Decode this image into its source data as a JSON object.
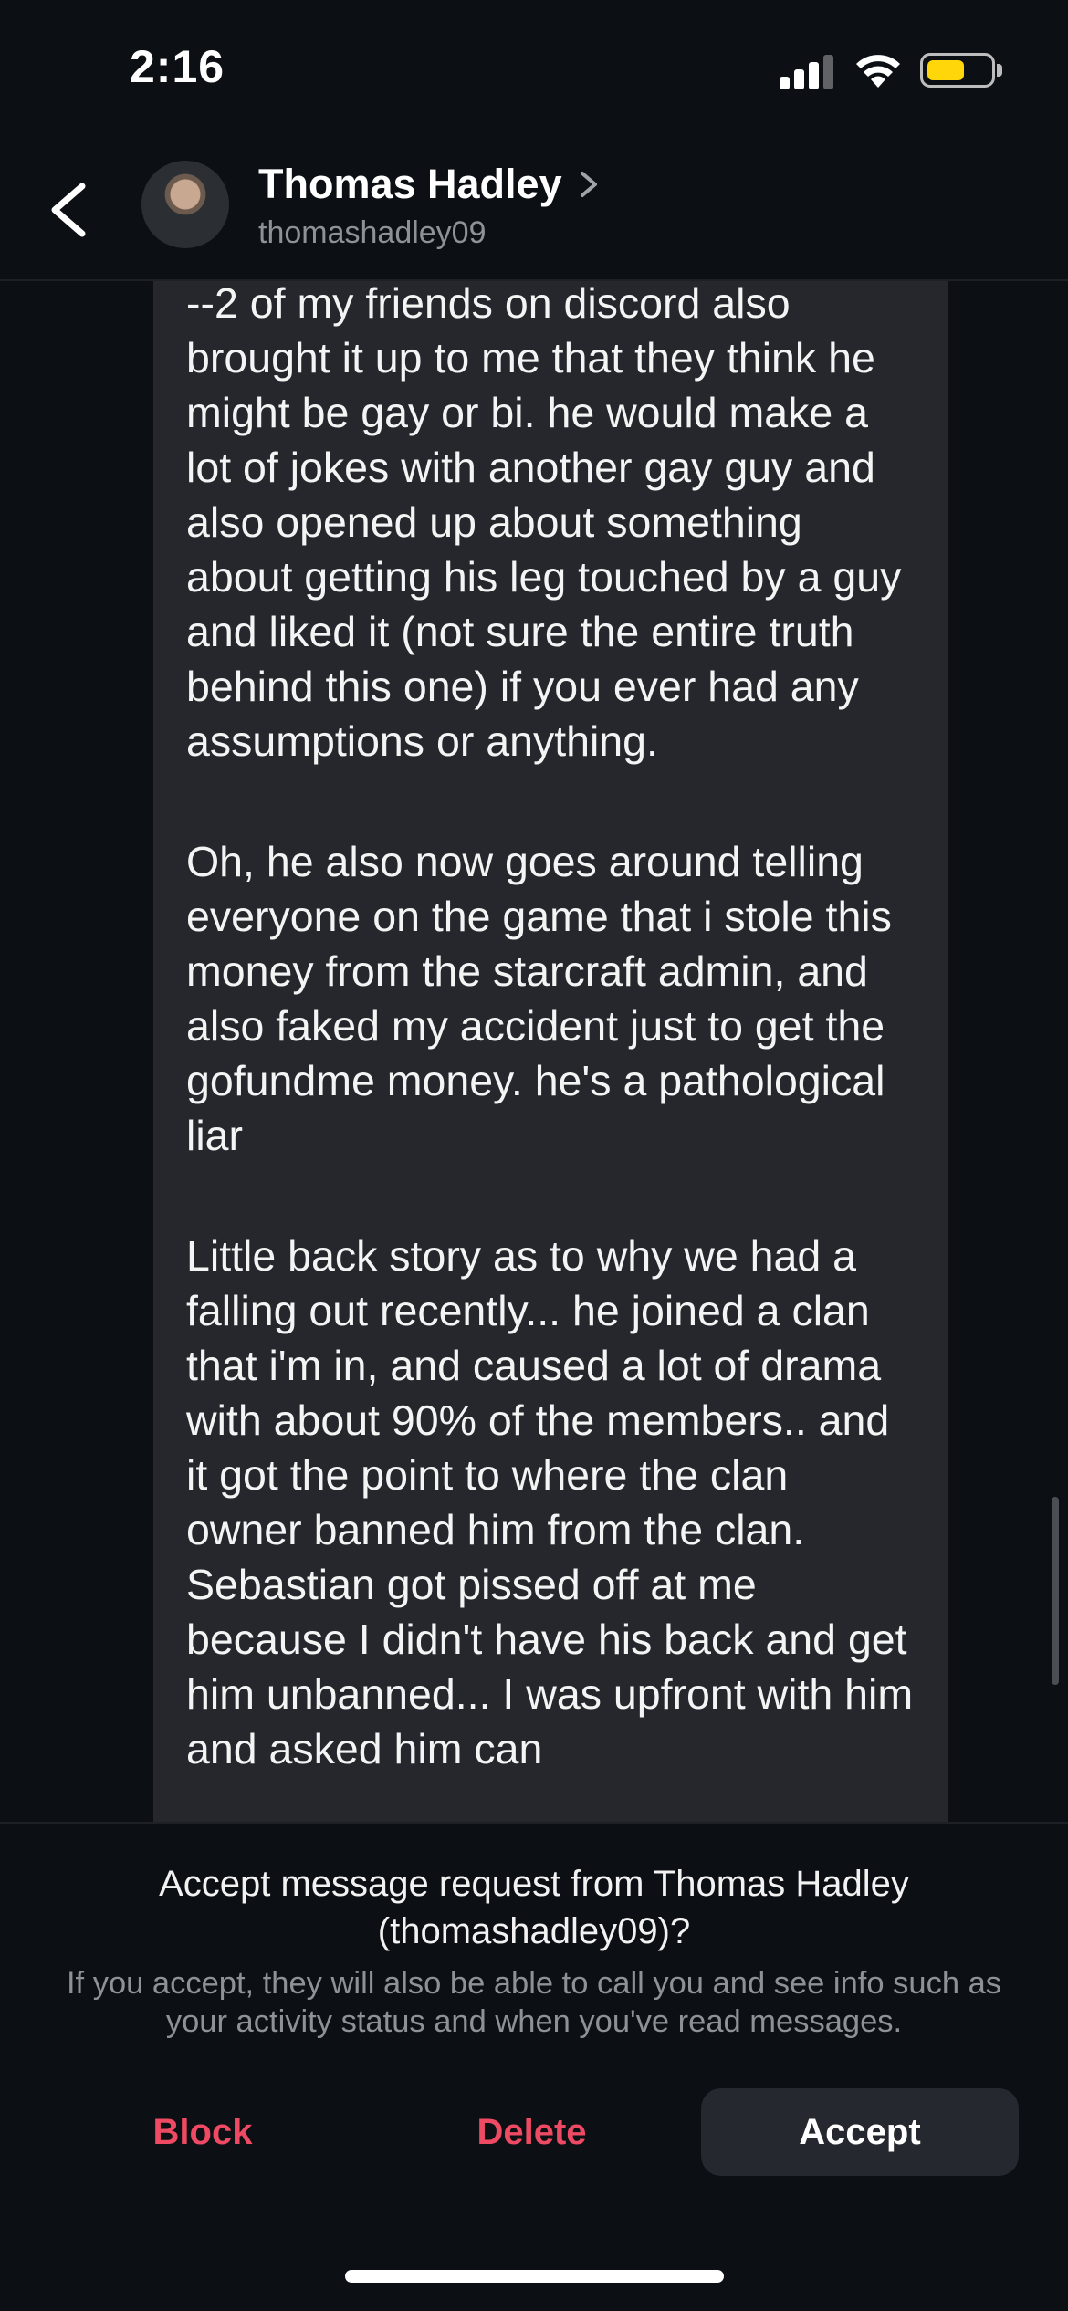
{
  "status_bar": {
    "time": "2:16",
    "battery_color": "#ffd60a"
  },
  "header": {
    "back_icon": "chevron-left-icon",
    "contact_name": "Thomas Hadley",
    "contact_username": "thomashadley09",
    "name_chevron_icon": "chevron-right-icon"
  },
  "message": {
    "paragraphs": [
      "--2 of my friends on discord also brought it up to me that they think he might be gay or bi. he would make a lot of jokes with another gay guy and also opened up about something about getting his leg touched by a guy and liked it (not sure the entire truth behind this one) if you ever had any assumptions or anything.",
      "Oh, he also now goes around telling everyone on the game that i stole this money from the starcraft admin, and also faked my accident just to get the gofundme money. he's a pathological liar",
      "Little back story as to why we had a falling out recently... he joined a clan that i'm in, and caused a lot of drama with about 90% of the members.. and it got the point to where the clan owner banned him from the clan. Sebastian got pissed off at me because I didn't have his back and get him unbanned... I was upfront with him and asked him can"
    ]
  },
  "request": {
    "title": "Accept message request from Thomas Hadley (thomashadley09)?",
    "description": "If you accept, they will also be able to call you and see info such as your activity status and when you've read messages.",
    "block_label": "Block",
    "delete_label": "Delete",
    "accept_label": "Accept",
    "danger_color": "#ee4a64"
  }
}
